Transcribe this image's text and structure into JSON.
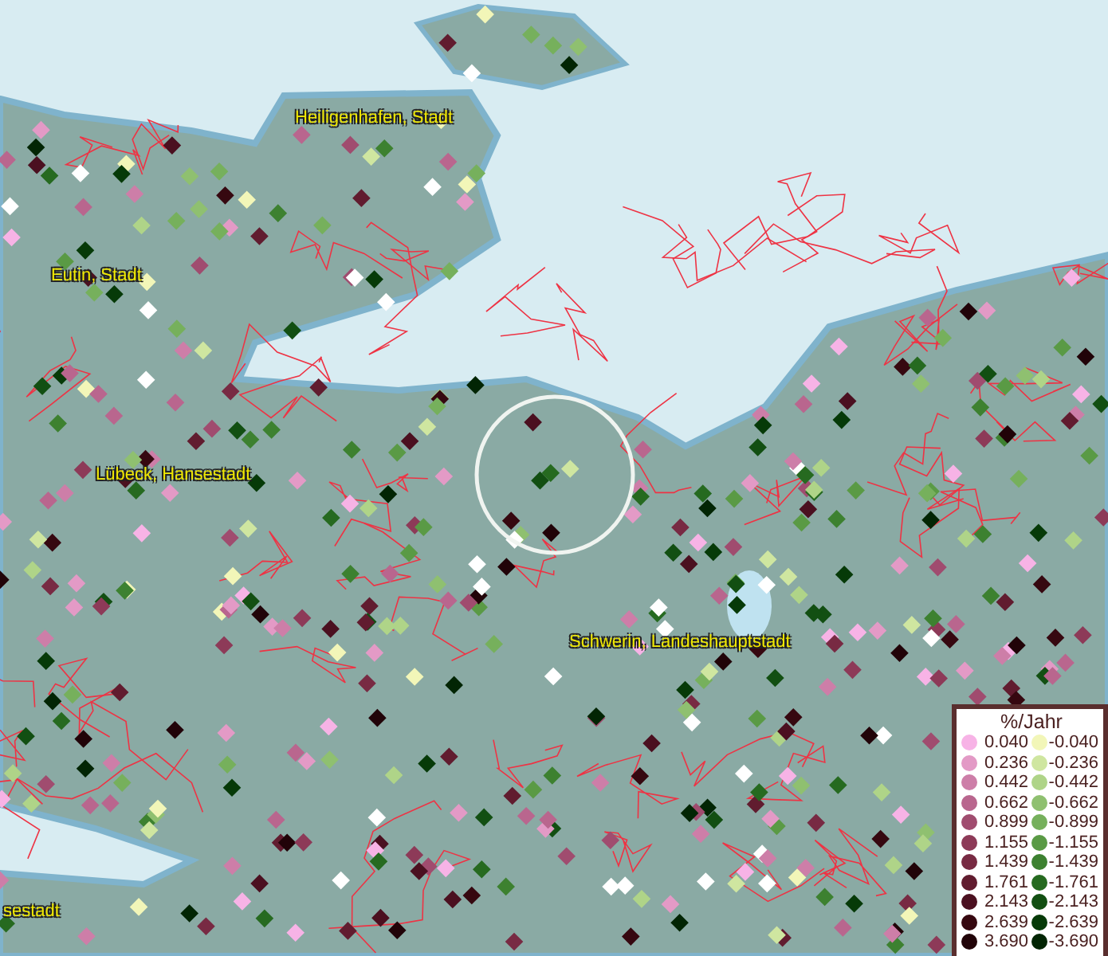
{
  "map": {
    "labels": [
      "Heiligenhafen, Stadt",
      "Eutin, Stadt",
      "Lübeck, Hansestadt",
      "Schwerin, Landeshauptstadt",
      "sestadt"
    ]
  },
  "legend": {
    "title": "%/Jahr",
    "rows": [
      {
        "positive": {
          "value": "0.040",
          "color": "#f7b3e6"
        },
        "negative": {
          "value": "-0.040",
          "color": "#f2f6b8"
        }
      },
      {
        "positive": {
          "value": "0.236",
          "color": "#e39ac6"
        },
        "negative": {
          "value": "-0.236",
          "color": "#cfe6a0"
        }
      },
      {
        "positive": {
          "value": "0.442",
          "color": "#cd7ea8"
        },
        "negative": {
          "value": "-0.442",
          "color": "#afd488"
        }
      },
      {
        "positive": {
          "value": "0.662",
          "color": "#b9668e"
        },
        "negative": {
          "value": "-0.662",
          "color": "#8fc070"
        }
      },
      {
        "positive": {
          "value": "0.899",
          "color": "#a04c6f"
        },
        "negative": {
          "value": "-0.899",
          "color": "#76b05c"
        }
      },
      {
        "positive": {
          "value": "1.155",
          "color": "#8d3a58"
        },
        "negative": {
          "value": "-1.155",
          "color": "#5a9a45"
        }
      },
      {
        "positive": {
          "value": "1.439",
          "color": "#782a43"
        },
        "negative": {
          "value": "-1.439",
          "color": "#3d8130"
        }
      },
      {
        "positive": {
          "value": "1.761",
          "color": "#611c2f"
        },
        "negative": {
          "value": "-1.761",
          "color": "#266a20"
        }
      },
      {
        "positive": {
          "value": "2.143",
          "color": "#4b1020"
        },
        "negative": {
          "value": "-2.143",
          "color": "#124f12"
        }
      },
      {
        "positive": {
          "value": "2.639",
          "color": "#360810"
        },
        "negative": {
          "value": "-2.639",
          "color": "#063a08"
        }
      },
      {
        "positive": {
          "value": "3.690",
          "color": "#210308"
        },
        "negative": {
          "value": "-3.690",
          "color": "#022504"
        }
      }
    ]
  }
}
